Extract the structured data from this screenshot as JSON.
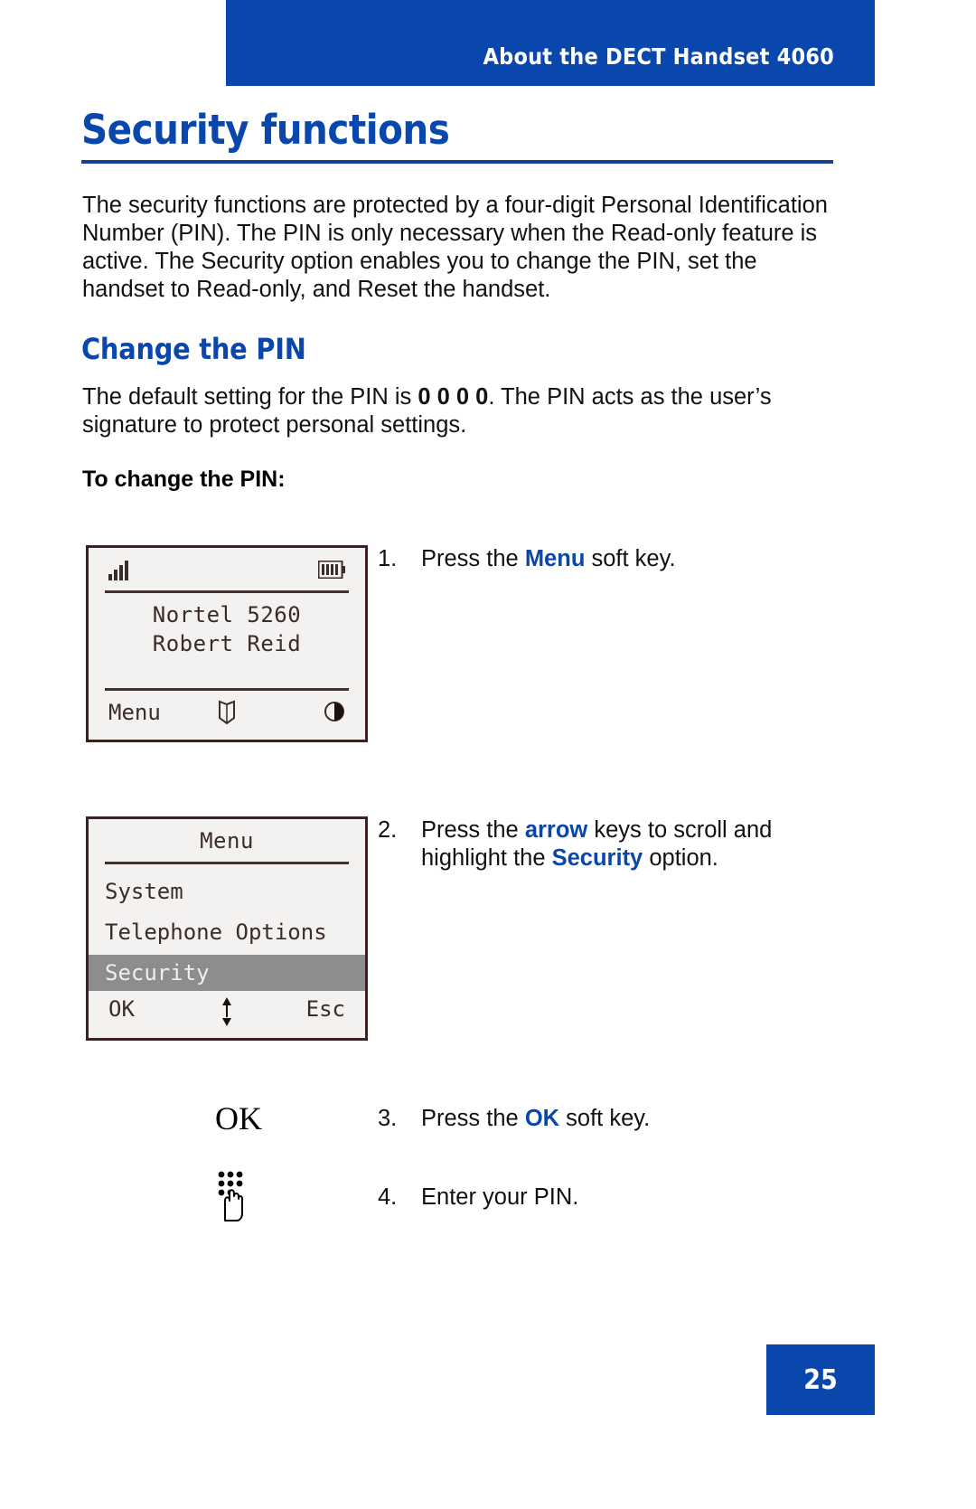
{
  "header": {
    "title": "About the DECT Handset 4060",
    "bar_color": "#0a47ad"
  },
  "page": {
    "title": "Security functions",
    "accent_color": "#0a47ad",
    "number": "25"
  },
  "intro": {
    "paragraph": "The security functions are protected by a four-digit Personal Identification Number (PIN). The PIN is only necessary when the Read-only feature is active. The Security option enables you to change the PIN, set the handset to Read-only, and Reset the handset."
  },
  "section": {
    "heading": "Change the PIN",
    "para_before": "The default setting for the PIN is ",
    "para_bold": "0 0 0 0",
    "para_after": ". The PIN acts as the user’s signature to protect personal settings.",
    "procedure_label": "To change the PIN:"
  },
  "screens": [
    {
      "id": "idle-screen",
      "status": {
        "signal_icon": "signal-bars-icon",
        "battery_icon": "battery-icon"
      },
      "lines": [
        "Nortel 5260",
        "Robert Reid"
      ],
      "softkeys": {
        "left": "Menu",
        "middle_icon": "phonebook-icon",
        "right_icon": "contrast-icon"
      }
    },
    {
      "id": "menu-screen",
      "title": "Menu",
      "items": [
        {
          "label": "System",
          "selected": false
        },
        {
          "label": "Telephone Options",
          "selected": false
        },
        {
          "label": "Security",
          "selected": true
        }
      ],
      "softkeys": {
        "left": "OK",
        "middle_icon": "up-down-arrow-icon",
        "right": "Esc"
      }
    }
  ],
  "steps": [
    {
      "num": "1.",
      "before": "Press the ",
      "keyword": "Menu",
      "after": " soft key.",
      "line2_before": "",
      "line2_keyword": "",
      "line2_after": ""
    },
    {
      "num": "2.",
      "before": "Press the ",
      "keyword": "arrow",
      "after": " keys to scroll and",
      "line2_before": "highlight the ",
      "line2_keyword": "Security",
      "line2_after": " option."
    },
    {
      "num": "3.",
      "before": "Press the ",
      "keyword": "OK",
      "after": " soft key.",
      "line2_before": "",
      "line2_keyword": "",
      "line2_after": ""
    },
    {
      "num": "4.",
      "before": "Enter your PIN.",
      "keyword": "",
      "after": "",
      "line2_before": "",
      "line2_keyword": "",
      "line2_after": ""
    }
  ],
  "glyphs": {
    "ok_key_label": "OK",
    "keypad_icon": "keypad-hand-icon"
  }
}
